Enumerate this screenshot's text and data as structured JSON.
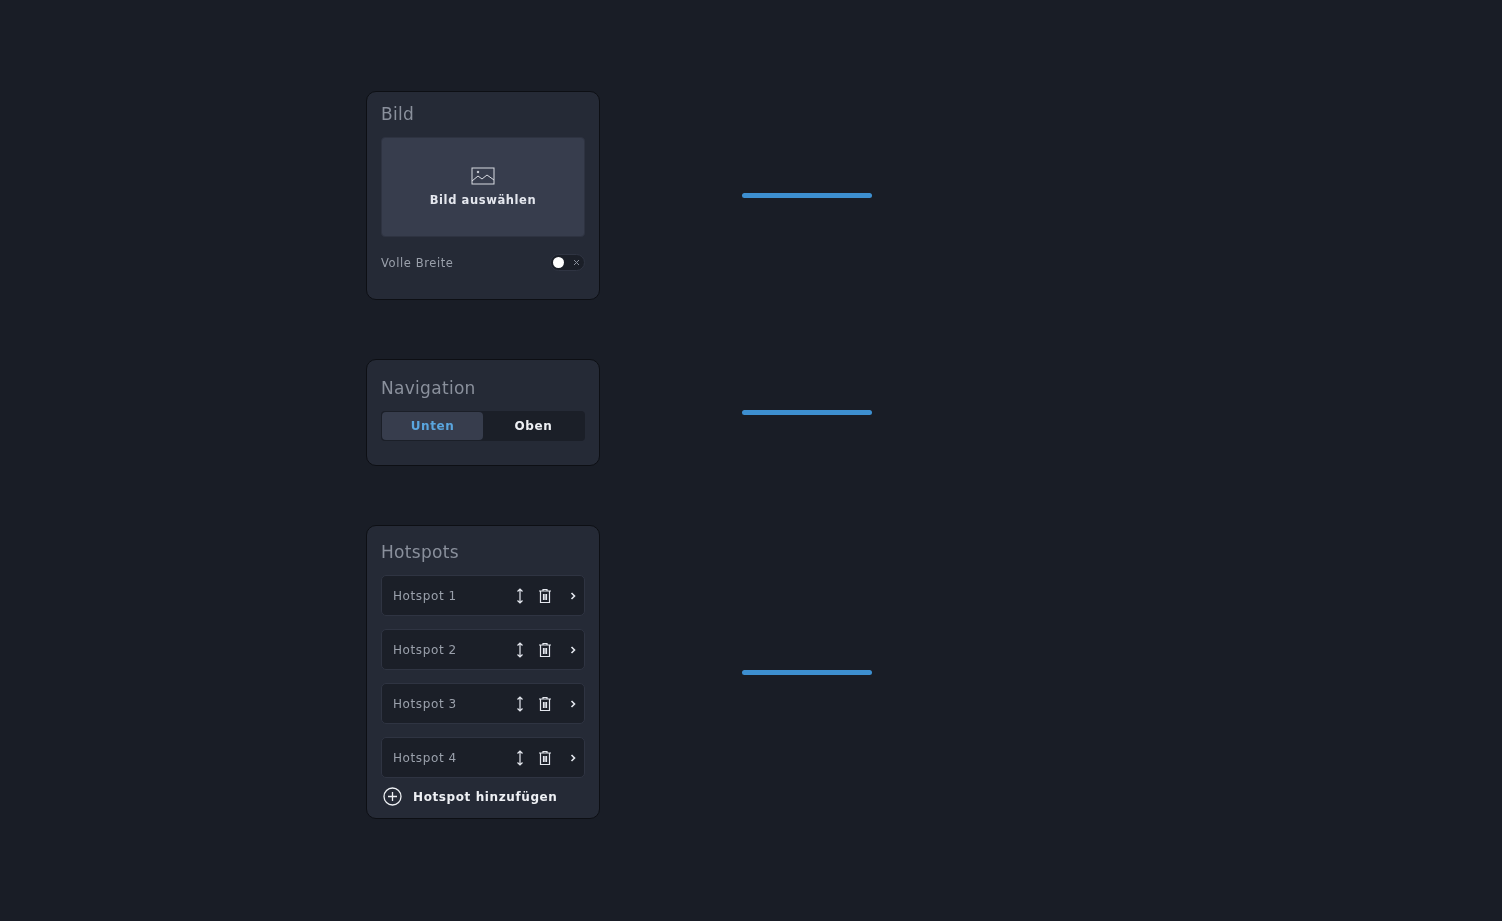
{
  "image_panel": {
    "title": "Bild",
    "picker_label": "Bild auswählen",
    "full_width": {
      "label": "Volle Breite",
      "on": false
    }
  },
  "navigation_panel": {
    "title": "Navigation",
    "options": [
      {
        "label": "Unten",
        "selected": true
      },
      {
        "label": "Oben",
        "selected": false
      }
    ]
  },
  "hotspots_panel": {
    "title": "Hotspots",
    "items": [
      {
        "label": "Hotspot 1"
      },
      {
        "label": "Hotspot 2"
      },
      {
        "label": "Hotspot 3"
      },
      {
        "label": "Hotspot 4"
      }
    ],
    "add_label": "Hotspot hinzufügen"
  }
}
